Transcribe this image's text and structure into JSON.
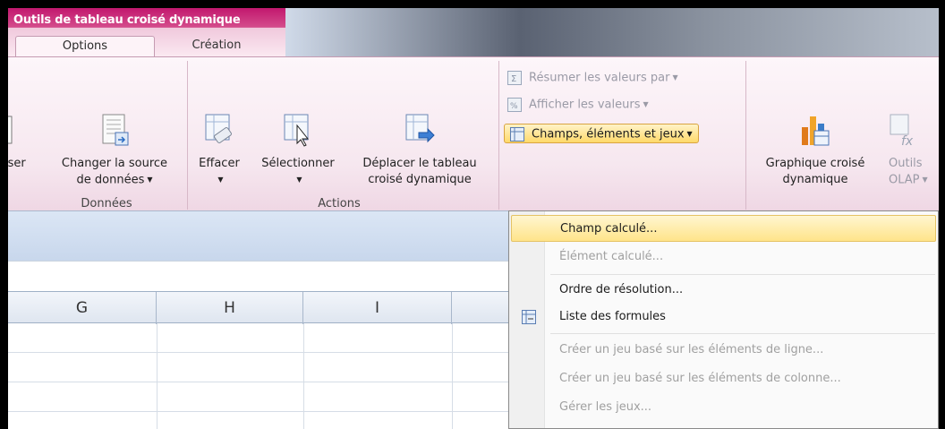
{
  "context_group": {
    "title": "Outils de tableau croisé dynamique"
  },
  "tabs": [
    {
      "label": "Options"
    },
    {
      "label": "Création"
    }
  ],
  "ribbon": {
    "donnees": {
      "cut_label": "iser",
      "changer_source": {
        "line1": "Changer la source",
        "line2": "de données"
      },
      "group_label": "Données"
    },
    "actions": {
      "effacer": "Effacer",
      "selectionner": "Sélectionner",
      "deplacer": {
        "line1": "Déplacer le tableau",
        "line2": "croisé dynamique"
      },
      "group_label": "Actions"
    },
    "calculs": {
      "resumer": "Résumer les valeurs par",
      "afficher": "Afficher les valeurs",
      "champs": "Champs, éléments et jeux"
    },
    "outils": {
      "graphique": {
        "line1": "Graphique croisé",
        "line2": "dynamique"
      },
      "olap": {
        "line1": "Outils",
        "line2": "OLAP"
      }
    }
  },
  "columns": [
    "G",
    "H",
    "I"
  ],
  "menu": {
    "items": [
      {
        "label": "Champ calculé...",
        "state": "hover"
      },
      {
        "label": "Élément calculé...",
        "state": "disabled"
      },
      {
        "label": "Ordre de résolution...",
        "state": "enabled"
      },
      {
        "label": "Liste des formules",
        "state": "enabled"
      },
      {
        "label": "Créer un jeu basé sur les éléments de ligne...",
        "state": "disabled"
      },
      {
        "label": "Créer un jeu basé sur les éléments de colonne...",
        "state": "disabled"
      },
      {
        "label": "Gérer les jeux...",
        "state": "disabled"
      }
    ]
  },
  "colors": {
    "context_accent": "#c2186e",
    "hover_gold": "#ffd96a",
    "header_blue": "#dfe6f0"
  }
}
